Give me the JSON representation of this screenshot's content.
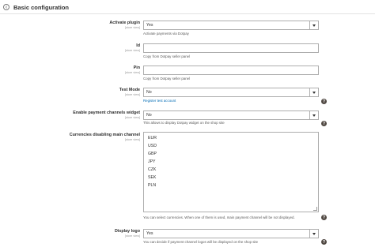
{
  "section": {
    "title": "Basic configuration",
    "toggle_icon": "collapse-circle-icon"
  },
  "fields": {
    "activate": {
      "label": "Activate plugin",
      "scope": "[store view]",
      "value": "Yes",
      "note": "Activate payments via Dotpay"
    },
    "id": {
      "label": "Id",
      "scope": "[store view]",
      "value": "",
      "note": "Copy from Dotpay seller panel"
    },
    "pin": {
      "label": "Pin",
      "scope": "[store view]",
      "value": "",
      "note": "Copy from Dotpay seller panel"
    },
    "test_mode": {
      "label": "Test Mode",
      "scope": "[store view]",
      "value": "No",
      "link": "Register test account"
    },
    "channels_widget": {
      "label": "Enable payment channels widget",
      "scope": "[store view]",
      "value": "No",
      "note": "This allows to display Dotpay widget on the shop site"
    },
    "currencies": {
      "label": "Currencies disabling main channel",
      "scope": "[store view]",
      "options": [
        "EUR",
        "USD",
        "GBP",
        "JPY",
        "CZK",
        "SEK",
        "PLN"
      ],
      "note": "You can select currencies. When one of them is used, main payment channel will be not displayed."
    },
    "logo": {
      "label": "Display logo",
      "scope": "[store view]",
      "value": "Yes",
      "note": "You can decide if payment channel logos will be displayed on the shop site"
    }
  },
  "help_icon_glyph": "?"
}
